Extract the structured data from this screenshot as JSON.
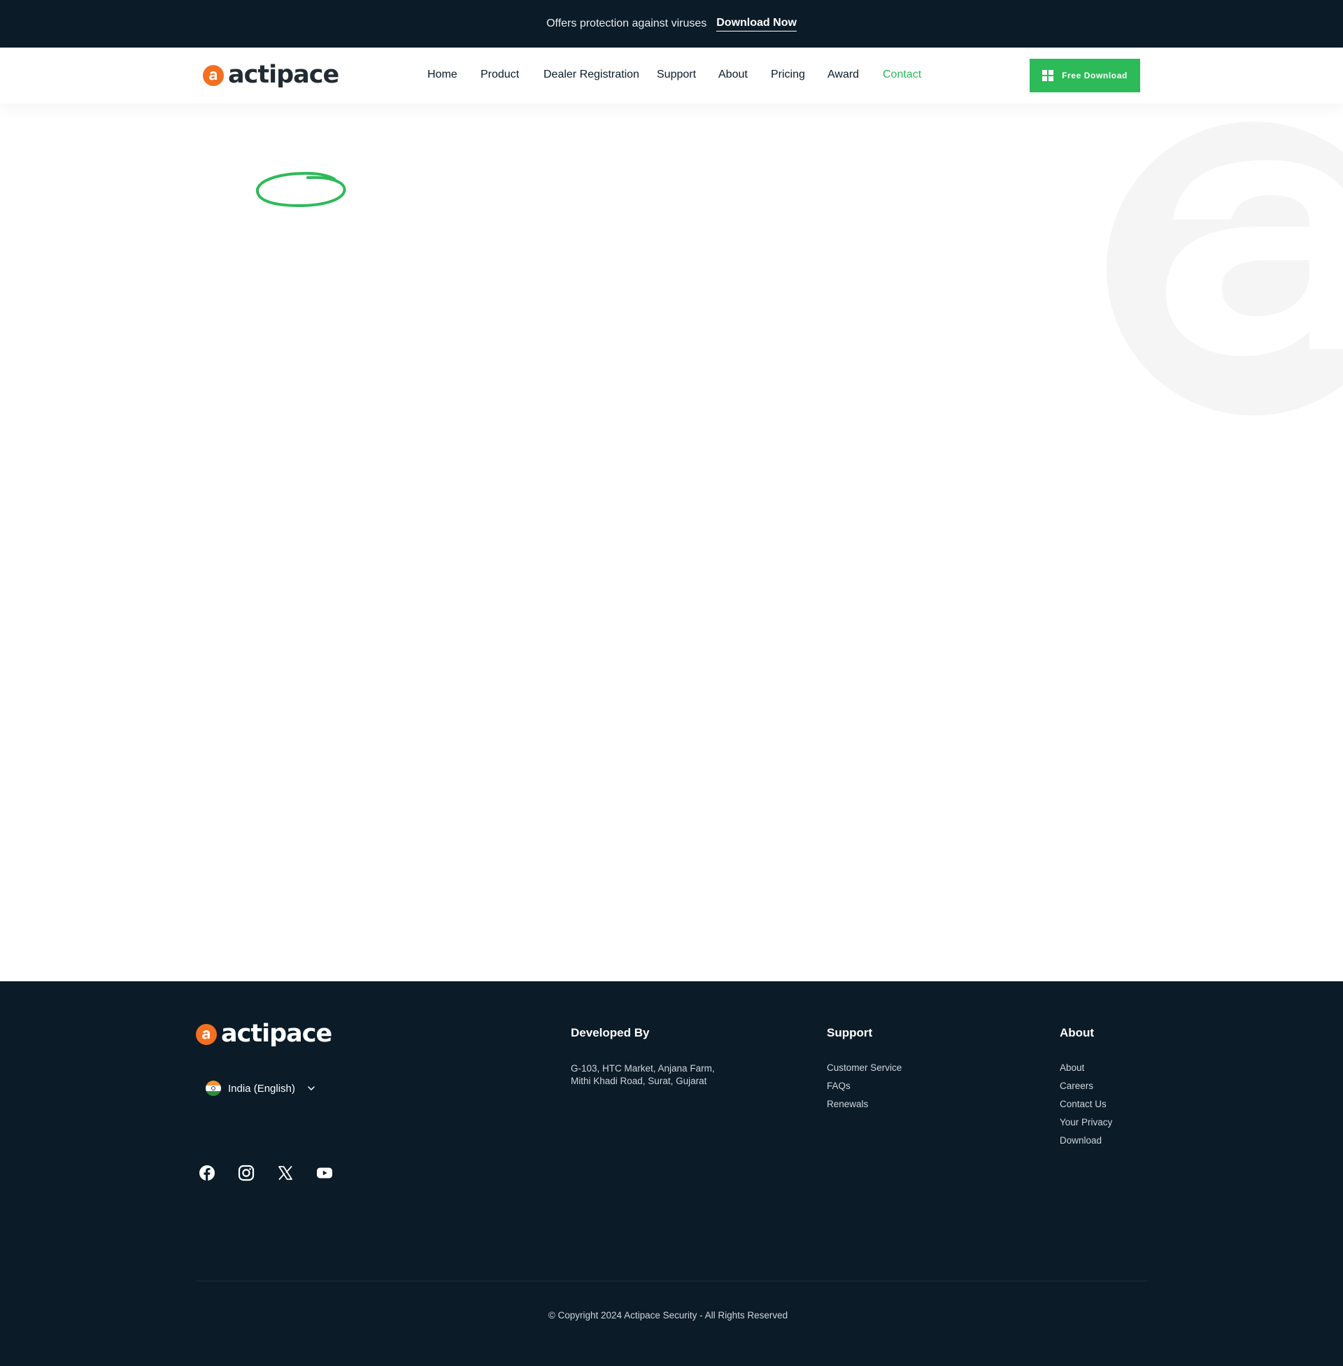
{
  "topbar": {
    "promo": "Offers protection against viruses",
    "download_link": "Download Now"
  },
  "brand": {
    "name": "actipace",
    "logo_icon": "actipace-a-logo-icon",
    "accent_color": "#f37021",
    "primary_color": "#2dba58",
    "dark_color": "#0b1b28"
  },
  "nav": {
    "items": [
      {
        "label": "Home"
      },
      {
        "label": "Product"
      },
      {
        "label": "Dealer Registration"
      },
      {
        "label": "Support"
      },
      {
        "label": "About"
      },
      {
        "label": "Pricing"
      },
      {
        "label": "Award"
      },
      {
        "label": "Contact",
        "active": true
      }
    ],
    "cta": {
      "label": "Free Download",
      "icon": "windows-icon"
    }
  },
  "footer": {
    "language": {
      "label": "India (English)",
      "icon": "india-flag-icon"
    },
    "socials": [
      "facebook-icon",
      "instagram-icon",
      "x-icon",
      "youtube-icon"
    ],
    "developed_by": {
      "heading": "Developed By",
      "address": "G-103, HTC Market, Anjana Farm, Mithi Khadi Road, Surat, Gujarat"
    },
    "support": {
      "heading": "Support",
      "links": [
        "Customer Service",
        "FAQs",
        "Renewals"
      ]
    },
    "about": {
      "heading": "About",
      "links": [
        "About",
        "Careers",
        "Contact Us",
        "Your Privacy",
        "Download"
      ]
    },
    "copyright": "© Copyright 2024 Actipace Security - All Rights Reserved"
  }
}
